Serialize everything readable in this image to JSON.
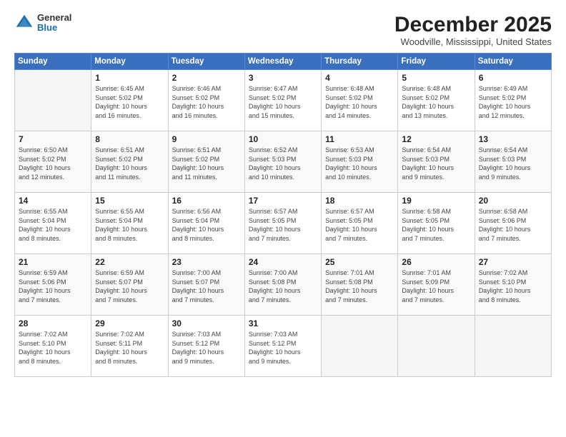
{
  "header": {
    "logo_general": "General",
    "logo_blue": "Blue",
    "month": "December 2025",
    "location": "Woodville, Mississippi, United States"
  },
  "weekdays": [
    "Sunday",
    "Monday",
    "Tuesday",
    "Wednesday",
    "Thursday",
    "Friday",
    "Saturday"
  ],
  "weeks": [
    [
      {
        "day": "",
        "info": ""
      },
      {
        "day": "1",
        "info": "Sunrise: 6:45 AM\nSunset: 5:02 PM\nDaylight: 10 hours\nand 16 minutes."
      },
      {
        "day": "2",
        "info": "Sunrise: 6:46 AM\nSunset: 5:02 PM\nDaylight: 10 hours\nand 16 minutes."
      },
      {
        "day": "3",
        "info": "Sunrise: 6:47 AM\nSunset: 5:02 PM\nDaylight: 10 hours\nand 15 minutes."
      },
      {
        "day": "4",
        "info": "Sunrise: 6:48 AM\nSunset: 5:02 PM\nDaylight: 10 hours\nand 14 minutes."
      },
      {
        "day": "5",
        "info": "Sunrise: 6:48 AM\nSunset: 5:02 PM\nDaylight: 10 hours\nand 13 minutes."
      },
      {
        "day": "6",
        "info": "Sunrise: 6:49 AM\nSunset: 5:02 PM\nDaylight: 10 hours\nand 12 minutes."
      }
    ],
    [
      {
        "day": "7",
        "info": "Sunrise: 6:50 AM\nSunset: 5:02 PM\nDaylight: 10 hours\nand 12 minutes."
      },
      {
        "day": "8",
        "info": "Sunrise: 6:51 AM\nSunset: 5:02 PM\nDaylight: 10 hours\nand 11 minutes."
      },
      {
        "day": "9",
        "info": "Sunrise: 6:51 AM\nSunset: 5:02 PM\nDaylight: 10 hours\nand 11 minutes."
      },
      {
        "day": "10",
        "info": "Sunrise: 6:52 AM\nSunset: 5:03 PM\nDaylight: 10 hours\nand 10 minutes."
      },
      {
        "day": "11",
        "info": "Sunrise: 6:53 AM\nSunset: 5:03 PM\nDaylight: 10 hours\nand 10 minutes."
      },
      {
        "day": "12",
        "info": "Sunrise: 6:54 AM\nSunset: 5:03 PM\nDaylight: 10 hours\nand 9 minutes."
      },
      {
        "day": "13",
        "info": "Sunrise: 6:54 AM\nSunset: 5:03 PM\nDaylight: 10 hours\nand 9 minutes."
      }
    ],
    [
      {
        "day": "14",
        "info": "Sunrise: 6:55 AM\nSunset: 5:04 PM\nDaylight: 10 hours\nand 8 minutes."
      },
      {
        "day": "15",
        "info": "Sunrise: 6:55 AM\nSunset: 5:04 PM\nDaylight: 10 hours\nand 8 minutes."
      },
      {
        "day": "16",
        "info": "Sunrise: 6:56 AM\nSunset: 5:04 PM\nDaylight: 10 hours\nand 8 minutes."
      },
      {
        "day": "17",
        "info": "Sunrise: 6:57 AM\nSunset: 5:05 PM\nDaylight: 10 hours\nand 7 minutes."
      },
      {
        "day": "18",
        "info": "Sunrise: 6:57 AM\nSunset: 5:05 PM\nDaylight: 10 hours\nand 7 minutes."
      },
      {
        "day": "19",
        "info": "Sunrise: 6:58 AM\nSunset: 5:05 PM\nDaylight: 10 hours\nand 7 minutes."
      },
      {
        "day": "20",
        "info": "Sunrise: 6:58 AM\nSunset: 5:06 PM\nDaylight: 10 hours\nand 7 minutes."
      }
    ],
    [
      {
        "day": "21",
        "info": "Sunrise: 6:59 AM\nSunset: 5:06 PM\nDaylight: 10 hours\nand 7 minutes."
      },
      {
        "day": "22",
        "info": "Sunrise: 6:59 AM\nSunset: 5:07 PM\nDaylight: 10 hours\nand 7 minutes."
      },
      {
        "day": "23",
        "info": "Sunrise: 7:00 AM\nSunset: 5:07 PM\nDaylight: 10 hours\nand 7 minutes."
      },
      {
        "day": "24",
        "info": "Sunrise: 7:00 AM\nSunset: 5:08 PM\nDaylight: 10 hours\nand 7 minutes."
      },
      {
        "day": "25",
        "info": "Sunrise: 7:01 AM\nSunset: 5:08 PM\nDaylight: 10 hours\nand 7 minutes."
      },
      {
        "day": "26",
        "info": "Sunrise: 7:01 AM\nSunset: 5:09 PM\nDaylight: 10 hours\nand 7 minutes."
      },
      {
        "day": "27",
        "info": "Sunrise: 7:02 AM\nSunset: 5:10 PM\nDaylight: 10 hours\nand 8 minutes."
      }
    ],
    [
      {
        "day": "28",
        "info": "Sunrise: 7:02 AM\nSunset: 5:10 PM\nDaylight: 10 hours\nand 8 minutes."
      },
      {
        "day": "29",
        "info": "Sunrise: 7:02 AM\nSunset: 5:11 PM\nDaylight: 10 hours\nand 8 minutes."
      },
      {
        "day": "30",
        "info": "Sunrise: 7:03 AM\nSunset: 5:12 PM\nDaylight: 10 hours\nand 9 minutes."
      },
      {
        "day": "31",
        "info": "Sunrise: 7:03 AM\nSunset: 5:12 PM\nDaylight: 10 hours\nand 9 minutes."
      },
      {
        "day": "",
        "info": ""
      },
      {
        "day": "",
        "info": ""
      },
      {
        "day": "",
        "info": ""
      }
    ]
  ]
}
